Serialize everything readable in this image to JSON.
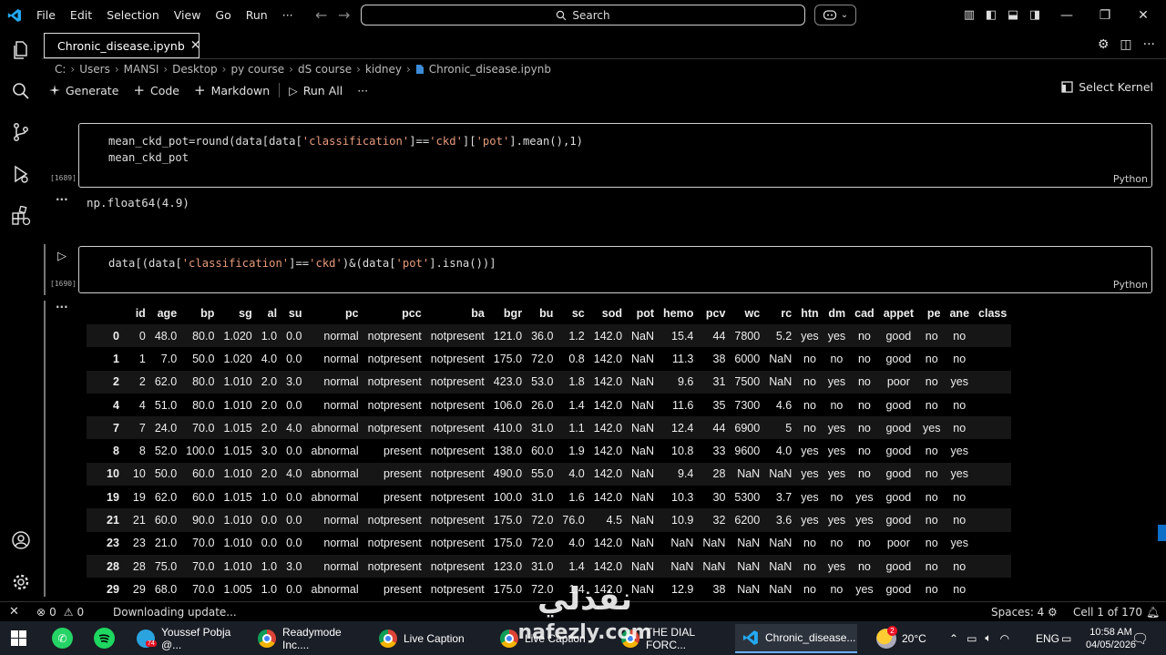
{
  "titlebar": {
    "menu": [
      "File",
      "Edit",
      "Selection",
      "View",
      "Go",
      "Run",
      "···"
    ],
    "search_placeholder": "Search"
  },
  "tab": {
    "filename": "Chronic_disease.ipynb"
  },
  "breadcrumb": [
    "C:",
    "Users",
    "MANSI",
    "Desktop",
    "py course",
    "dS course",
    "kidney",
    "Chronic_disease.ipynb"
  ],
  "nb_toolbar": {
    "generate": "Generate",
    "code": "Code",
    "markdown": "Markdown",
    "run_all": "Run All",
    "more": "···",
    "select_kernel": "Select Kernel"
  },
  "cells": [
    {
      "exec": "[1689]",
      "line1": "mean_ckd_pot=round(data[data['classification']=='ckd']['pot'].mean(),1)",
      "line2": "mean_ckd_pot",
      "lang": "Python",
      "output_dots": "···",
      "output": "np.float64(4.9)"
    },
    {
      "exec": "[1690]",
      "line1": "data[(data['classification']=='ckd')&(data['pot'].isna())]",
      "lang": "Python",
      "output_dots": "···"
    }
  ],
  "dataframe": {
    "columns": [
      "",
      "id",
      "age",
      "bp",
      "sg",
      "al",
      "su",
      "pc",
      "pcc",
      "ba",
      "bgr",
      "bu",
      "sc",
      "sod",
      "pot",
      "hemo",
      "pcv",
      "wc",
      "rc",
      "htn",
      "dm",
      "cad",
      "appet",
      "pe",
      "ane",
      "class"
    ],
    "rows": [
      [
        "0",
        "0",
        "48.0",
        "80.0",
        "1.020",
        "1.0",
        "0.0",
        "normal",
        "notpresent",
        "notpresent",
        "121.0",
        "36.0",
        "1.2",
        "142.0",
        "NaN",
        "15.4",
        "44",
        "7800",
        "5.2",
        "yes",
        "yes",
        "no",
        "good",
        "no",
        "no",
        ""
      ],
      [
        "1",
        "1",
        "7.0",
        "50.0",
        "1.020",
        "4.0",
        "0.0",
        "normal",
        "notpresent",
        "notpresent",
        "175.0",
        "72.0",
        "0.8",
        "142.0",
        "NaN",
        "11.3",
        "38",
        "6000",
        "NaN",
        "no",
        "no",
        "no",
        "good",
        "no",
        "no",
        ""
      ],
      [
        "2",
        "2",
        "62.0",
        "80.0",
        "1.010",
        "2.0",
        "3.0",
        "normal",
        "notpresent",
        "notpresent",
        "423.0",
        "53.0",
        "1.8",
        "142.0",
        "NaN",
        "9.6",
        "31",
        "7500",
        "NaN",
        "no",
        "yes",
        "no",
        "poor",
        "no",
        "yes",
        ""
      ],
      [
        "4",
        "4",
        "51.0",
        "80.0",
        "1.010",
        "2.0",
        "0.0",
        "normal",
        "notpresent",
        "notpresent",
        "106.0",
        "26.0",
        "1.4",
        "142.0",
        "NaN",
        "11.6",
        "35",
        "7300",
        "4.6",
        "no",
        "no",
        "no",
        "good",
        "no",
        "no",
        ""
      ],
      [
        "7",
        "7",
        "24.0",
        "70.0",
        "1.015",
        "2.0",
        "4.0",
        "abnormal",
        "notpresent",
        "notpresent",
        "410.0",
        "31.0",
        "1.1",
        "142.0",
        "NaN",
        "12.4",
        "44",
        "6900",
        "5",
        "no",
        "yes",
        "no",
        "good",
        "yes",
        "no",
        ""
      ],
      [
        "8",
        "8",
        "52.0",
        "100.0",
        "1.015",
        "3.0",
        "0.0",
        "abnormal",
        "present",
        "notpresent",
        "138.0",
        "60.0",
        "1.9",
        "142.0",
        "NaN",
        "10.8",
        "33",
        "9600",
        "4.0",
        "yes",
        "yes",
        "no",
        "good",
        "no",
        "yes",
        ""
      ],
      [
        "10",
        "10",
        "50.0",
        "60.0",
        "1.010",
        "2.0",
        "4.0",
        "abnormal",
        "present",
        "notpresent",
        "490.0",
        "55.0",
        "4.0",
        "142.0",
        "NaN",
        "9.4",
        "28",
        "NaN",
        "NaN",
        "yes",
        "yes",
        "no",
        "good",
        "no",
        "yes",
        ""
      ],
      [
        "19",
        "19",
        "62.0",
        "60.0",
        "1.015",
        "1.0",
        "0.0",
        "abnormal",
        "present",
        "notpresent",
        "100.0",
        "31.0",
        "1.6",
        "142.0",
        "NaN",
        "10.3",
        "30",
        "5300",
        "3.7",
        "yes",
        "no",
        "yes",
        "good",
        "no",
        "no",
        ""
      ],
      [
        "21",
        "21",
        "60.0",
        "90.0",
        "1.010",
        "0.0",
        "0.0",
        "normal",
        "notpresent",
        "notpresent",
        "175.0",
        "72.0",
        "76.0",
        "4.5",
        "NaN",
        "10.9",
        "32",
        "6200",
        "3.6",
        "yes",
        "yes",
        "yes",
        "good",
        "no",
        "no",
        ""
      ],
      [
        "23",
        "23",
        "21.0",
        "70.0",
        "1.010",
        "0.0",
        "0.0",
        "normal",
        "notpresent",
        "notpresent",
        "175.0",
        "72.0",
        "4.0",
        "142.0",
        "NaN",
        "NaN",
        "NaN",
        "NaN",
        "NaN",
        "no",
        "no",
        "no",
        "poor",
        "no",
        "yes",
        ""
      ],
      [
        "28",
        "28",
        "75.0",
        "70.0",
        "1.010",
        "1.0",
        "3.0",
        "normal",
        "notpresent",
        "notpresent",
        "123.0",
        "31.0",
        "1.4",
        "142.0",
        "NaN",
        "NaN",
        "NaN",
        "NaN",
        "NaN",
        "no",
        "yes",
        "no",
        "good",
        "no",
        "no",
        ""
      ],
      [
        "29",
        "29",
        "68.0",
        "70.0",
        "1.005",
        "1.0",
        "0.0",
        "abnormal",
        "present",
        "notpresent",
        "175.0",
        "72.0",
        "1.4",
        "142.0",
        "NaN",
        "12.9",
        "38",
        "NaN",
        "NaN",
        "no",
        "no",
        "yes",
        "good",
        "no",
        "no",
        ""
      ]
    ]
  },
  "statusbar": {
    "errors": "0",
    "warnings": "0",
    "message": "Downloading update...",
    "spaces": "Spaces: 4",
    "cell_pos": "Cell 1 of 170"
  },
  "taskbar": {
    "apps": [
      {
        "label": "Youssef Pobja @...",
        "badge": "74"
      },
      {
        "label": "Readymode Inc...."
      },
      {
        "label": "Live Caption"
      },
      {
        "label": "Live Caption"
      },
      {
        "label": "THE DIAL FORC..."
      },
      {
        "label": "Chronic_disease..."
      }
    ],
    "weather_badge": "2",
    "temperature": "20°C",
    "language": "ENG",
    "time": "10:58 AM",
    "date": "04/05/2026"
  },
  "watermark": {
    "arabic": "نفذلي",
    "latin": "nafezly.com"
  },
  "colors": {
    "accent": "#0e6fc9",
    "vscode_blue": "#23a9f2",
    "string": "#e69a7a",
    "row_alt": "#161616",
    "taskbar": "#1a1e26"
  }
}
